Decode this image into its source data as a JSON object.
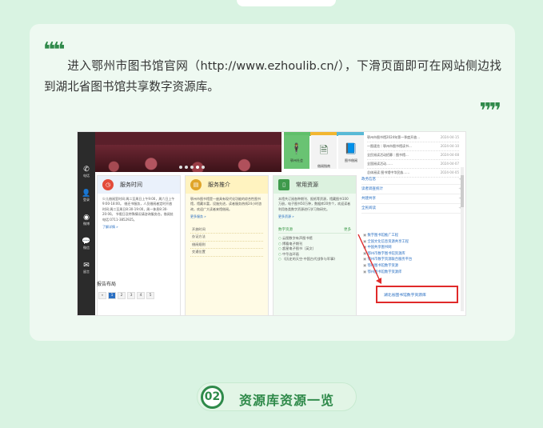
{
  "article": {
    "intro": "进入鄂州市图书馆官网（http://www.ezhoulib.cn/），下滑页面即可在网站侧边找到湖北省图书馆共享数字资源库。",
    "section_number": "02",
    "section_title": "资源库资源一览"
  },
  "screenshot": {
    "sidebar": [
      {
        "icon": "phone-icon",
        "glyph": "✆",
        "label": "电话"
      },
      {
        "icon": "user-icon",
        "glyph": "👤",
        "label": "登录"
      },
      {
        "icon": "weibo-icon",
        "glyph": "◉",
        "label": "微博"
      },
      {
        "icon": "wechat-icon",
        "glyph": "💬",
        "label": "微信"
      },
      {
        "icon": "message-icon",
        "glyph": "✉",
        "label": "留言"
      }
    ],
    "tiles": [
      {
        "icon": "person-icon",
        "glyph": "🕴",
        "label": "鄂州社会"
      },
      {
        "icon": "document-icon",
        "glyph": "🗎",
        "label": "借阅指南"
      },
      {
        "icon": "book-icon",
        "glyph": "📘",
        "label": "图书借阅"
      }
    ],
    "news": [
      {
        "title": "鄂州市图书馆2024年第一季度开放...",
        "date": "2024-04-15"
      },
      {
        "title": "一图速览｜鄂州市图书馆读书...",
        "date": "2024-04-10"
      },
      {
        "title": "全民阅读活动招募｜图书馆...",
        "date": "2024-04-08"
      },
      {
        "title": "全国阅读活动……",
        "date": "2024-04-07"
      },
      {
        "title": "总体阅读 图书馆中华民族……",
        "date": "2024-04-05"
      }
    ],
    "panel_service": {
      "title": "服务时间",
      "body": "少儿借阅室时间:周二至周日上午9:00，周六日上午9:00-18:00。 借还书服务，人员借阅者定时开放时间:周二至周日8:30-19:00，周一休息8:30-20:00。 节假日及特殊情况请咨询服务台。借阅处电话:0711-3852925。",
      "more": "了解详情 »"
    },
    "panel_recommend": {
      "title": "服务推介",
      "body": "鄂州市图书馆是一座具有现代化功能的综合性图书馆，馆藏丰富，设施先进，读者服务热线24小时咨询，欢迎广大读者来馆借阅。",
      "more": "更多服务 »",
      "items": [
        "开放时间",
        "办证方法",
        "借阅规则",
        "交通位置"
      ]
    },
    "panel_common": {
      "title": "常用资源",
      "body": "本馆共订阅各种期刊、报纸等资源，馆藏图书100万册，电子图书50万种，数据库20余个，欢迎读者利用各类数字资源进行学习和研究。",
      "more": "更多资源 »",
      "digital_label": "数字资源",
      "digital_more": "更多",
      "items": [
        "云图数字有声图书馆",
        "博看电子期刊",
        "超星电子图书（英文）",
        "中华连环画",
        "《历史的天空·中国古代战争与军事》"
      ]
    },
    "notice": {
      "title": "报告布局",
      "pages": [
        "«",
        "1",
        "2",
        "3",
        "4",
        "5"
      ]
    },
    "links": [
      {
        "label": "政务信息"
      },
      {
        "label": "读者调查统计"
      },
      {
        "label": "共建共享"
      },
      {
        "label": "全民阅读"
      }
    ],
    "resources": [
      "数字图书馆推广工程",
      "全国文化信息资源共享工程",
      "中国共享图书网",
      "鄂州市数字图书馆资源库",
      "鄂州市数字资源联合服务平台",
      "鄂州图书馆数字资源",
      "鄂州图书馆数字资源库"
    ],
    "highlight": "湖北省图书馆数字资源库"
  }
}
